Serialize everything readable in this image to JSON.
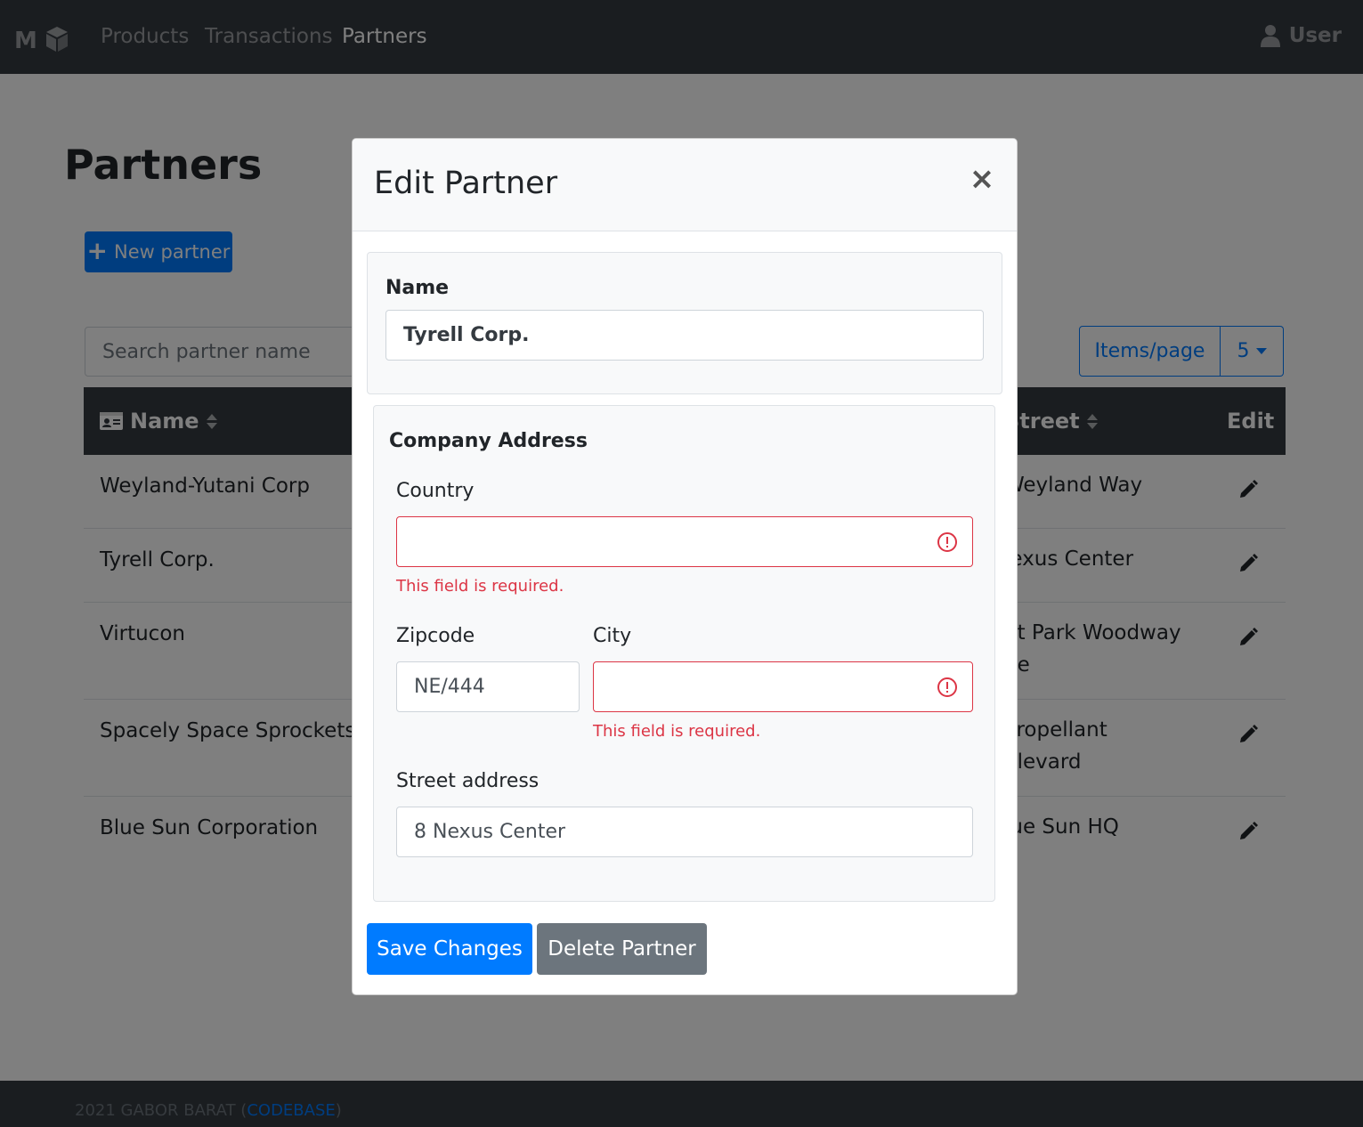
{
  "nav": {
    "brand_icon": "cube-logo-icon",
    "links": [
      "Products",
      "Transactions",
      "Partners"
    ],
    "active": "Partners",
    "user_label": "User",
    "user_icon": "user-icon"
  },
  "page": {
    "title": "Partners",
    "new_button_label": "New partner",
    "search_placeholder": "Search partner name",
    "items_per_page_label": "Items/page",
    "items_per_page_value": "5"
  },
  "table": {
    "headers": {
      "name": "Name",
      "street": "Street",
      "edit": "Edit"
    },
    "rows": [
      {
        "name": "Weyland-Yutani Corp",
        "street": "Weyland Way"
      },
      {
        "name": "Tyrell Corp.",
        "street": "lexus Center"
      },
      {
        "name": "Virtucon",
        "street": "nt Park Woodway\nne"
      },
      {
        "name": "Spacely Space Sprockets",
        "street": "Propellant\nulevard"
      },
      {
        "name": "Blue Sun Corporation",
        "street": "lue Sun HQ"
      }
    ]
  },
  "modal": {
    "title": "Edit Partner",
    "close_glyph": "×",
    "name_label": "Name",
    "name_value": "Tyrell Corp.",
    "address_title": "Company Address",
    "country_label": "Country",
    "country_value": "",
    "country_error": "This field is required.",
    "zipcode_label": "Zipcode",
    "zipcode_value": "NE/444",
    "city_label": "City",
    "city_value": "",
    "city_error": "This field is required.",
    "street_label": "Street address",
    "street_value": "8 Nexus Center",
    "save_label": "Save Changes",
    "delete_label": "Delete Partner"
  },
  "footer": {
    "text": "2021 GABOR BARAT (",
    "link": "CODEBASE",
    "close_paren": ")"
  },
  "colors": {
    "primary": "#007bff",
    "danger": "#dc3545",
    "secondary": "#6c757d",
    "dark": "#343a40"
  }
}
